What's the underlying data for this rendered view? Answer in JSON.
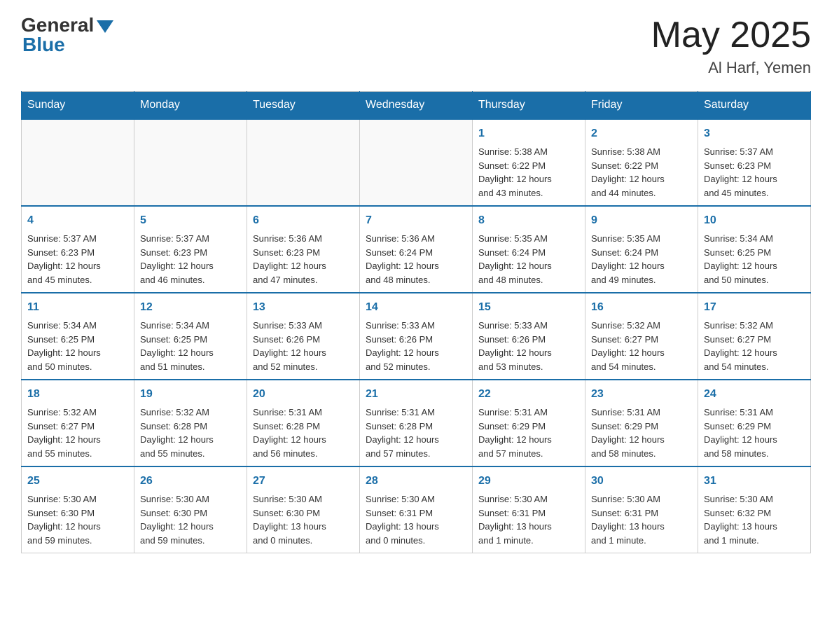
{
  "header": {
    "logo_general": "General",
    "logo_blue": "Blue",
    "month_title": "May 2025",
    "location": "Al Harf, Yemen"
  },
  "days_of_week": [
    "Sunday",
    "Monday",
    "Tuesday",
    "Wednesday",
    "Thursday",
    "Friday",
    "Saturday"
  ],
  "weeks": [
    [
      {
        "day": "",
        "info": ""
      },
      {
        "day": "",
        "info": ""
      },
      {
        "day": "",
        "info": ""
      },
      {
        "day": "",
        "info": ""
      },
      {
        "day": "1",
        "info": "Sunrise: 5:38 AM\nSunset: 6:22 PM\nDaylight: 12 hours\nand 43 minutes."
      },
      {
        "day": "2",
        "info": "Sunrise: 5:38 AM\nSunset: 6:22 PM\nDaylight: 12 hours\nand 44 minutes."
      },
      {
        "day": "3",
        "info": "Sunrise: 5:37 AM\nSunset: 6:23 PM\nDaylight: 12 hours\nand 45 minutes."
      }
    ],
    [
      {
        "day": "4",
        "info": "Sunrise: 5:37 AM\nSunset: 6:23 PM\nDaylight: 12 hours\nand 45 minutes."
      },
      {
        "day": "5",
        "info": "Sunrise: 5:37 AM\nSunset: 6:23 PM\nDaylight: 12 hours\nand 46 minutes."
      },
      {
        "day": "6",
        "info": "Sunrise: 5:36 AM\nSunset: 6:23 PM\nDaylight: 12 hours\nand 47 minutes."
      },
      {
        "day": "7",
        "info": "Sunrise: 5:36 AM\nSunset: 6:24 PM\nDaylight: 12 hours\nand 48 minutes."
      },
      {
        "day": "8",
        "info": "Sunrise: 5:35 AM\nSunset: 6:24 PM\nDaylight: 12 hours\nand 48 minutes."
      },
      {
        "day": "9",
        "info": "Sunrise: 5:35 AM\nSunset: 6:24 PM\nDaylight: 12 hours\nand 49 minutes."
      },
      {
        "day": "10",
        "info": "Sunrise: 5:34 AM\nSunset: 6:25 PM\nDaylight: 12 hours\nand 50 minutes."
      }
    ],
    [
      {
        "day": "11",
        "info": "Sunrise: 5:34 AM\nSunset: 6:25 PM\nDaylight: 12 hours\nand 50 minutes."
      },
      {
        "day": "12",
        "info": "Sunrise: 5:34 AM\nSunset: 6:25 PM\nDaylight: 12 hours\nand 51 minutes."
      },
      {
        "day": "13",
        "info": "Sunrise: 5:33 AM\nSunset: 6:26 PM\nDaylight: 12 hours\nand 52 minutes."
      },
      {
        "day": "14",
        "info": "Sunrise: 5:33 AM\nSunset: 6:26 PM\nDaylight: 12 hours\nand 52 minutes."
      },
      {
        "day": "15",
        "info": "Sunrise: 5:33 AM\nSunset: 6:26 PM\nDaylight: 12 hours\nand 53 minutes."
      },
      {
        "day": "16",
        "info": "Sunrise: 5:32 AM\nSunset: 6:27 PM\nDaylight: 12 hours\nand 54 minutes."
      },
      {
        "day": "17",
        "info": "Sunrise: 5:32 AM\nSunset: 6:27 PM\nDaylight: 12 hours\nand 54 minutes."
      }
    ],
    [
      {
        "day": "18",
        "info": "Sunrise: 5:32 AM\nSunset: 6:27 PM\nDaylight: 12 hours\nand 55 minutes."
      },
      {
        "day": "19",
        "info": "Sunrise: 5:32 AM\nSunset: 6:28 PM\nDaylight: 12 hours\nand 55 minutes."
      },
      {
        "day": "20",
        "info": "Sunrise: 5:31 AM\nSunset: 6:28 PM\nDaylight: 12 hours\nand 56 minutes."
      },
      {
        "day": "21",
        "info": "Sunrise: 5:31 AM\nSunset: 6:28 PM\nDaylight: 12 hours\nand 57 minutes."
      },
      {
        "day": "22",
        "info": "Sunrise: 5:31 AM\nSunset: 6:29 PM\nDaylight: 12 hours\nand 57 minutes."
      },
      {
        "day": "23",
        "info": "Sunrise: 5:31 AM\nSunset: 6:29 PM\nDaylight: 12 hours\nand 58 minutes."
      },
      {
        "day": "24",
        "info": "Sunrise: 5:31 AM\nSunset: 6:29 PM\nDaylight: 12 hours\nand 58 minutes."
      }
    ],
    [
      {
        "day": "25",
        "info": "Sunrise: 5:30 AM\nSunset: 6:30 PM\nDaylight: 12 hours\nand 59 minutes."
      },
      {
        "day": "26",
        "info": "Sunrise: 5:30 AM\nSunset: 6:30 PM\nDaylight: 12 hours\nand 59 minutes."
      },
      {
        "day": "27",
        "info": "Sunrise: 5:30 AM\nSunset: 6:30 PM\nDaylight: 13 hours\nand 0 minutes."
      },
      {
        "day": "28",
        "info": "Sunrise: 5:30 AM\nSunset: 6:31 PM\nDaylight: 13 hours\nand 0 minutes."
      },
      {
        "day": "29",
        "info": "Sunrise: 5:30 AM\nSunset: 6:31 PM\nDaylight: 13 hours\nand 1 minute."
      },
      {
        "day": "30",
        "info": "Sunrise: 5:30 AM\nSunset: 6:31 PM\nDaylight: 13 hours\nand 1 minute."
      },
      {
        "day": "31",
        "info": "Sunrise: 5:30 AM\nSunset: 6:32 PM\nDaylight: 13 hours\nand 1 minute."
      }
    ]
  ]
}
